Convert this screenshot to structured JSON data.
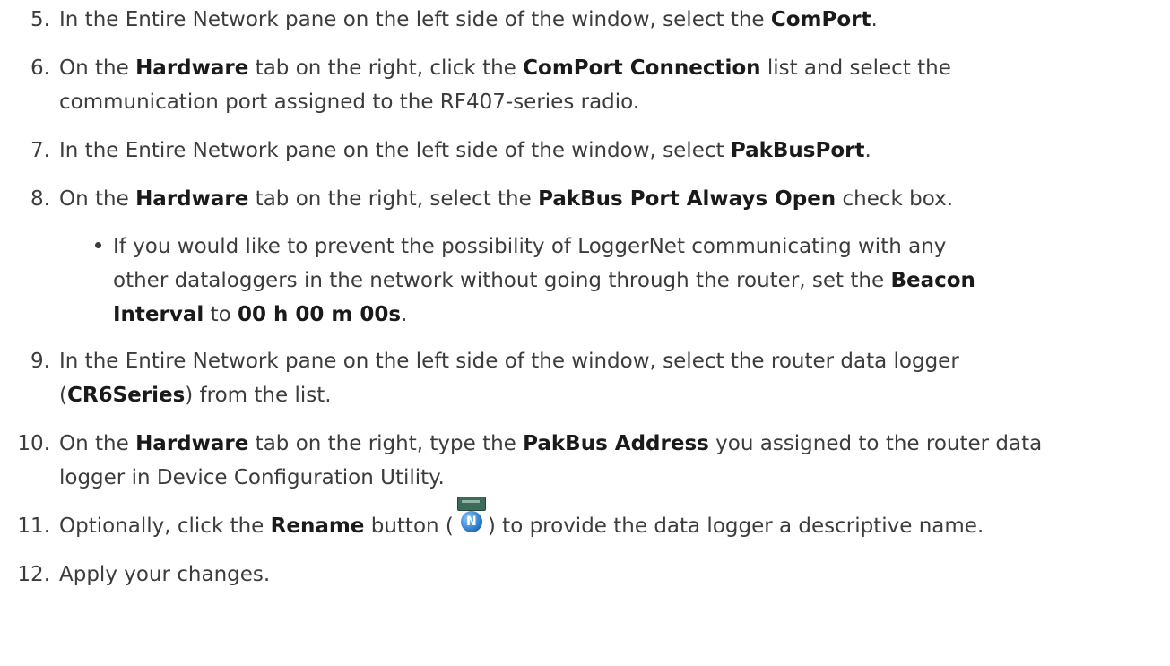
{
  "steps": [
    {
      "number": "5.",
      "parts": [
        "In the Entire Network pane on the left side of the window, select the ",
        "ComPort",
        "."
      ]
    },
    {
      "number": "6.",
      "line1": [
        "On the ",
        "Hardware",
        " tab on the right, click the ",
        "ComPort Connection",
        " list and select the"
      ],
      "line2": "communication port assigned to the RF407-series radio."
    },
    {
      "number": "7.",
      "parts": [
        "In the Entire Network pane on the left side of the window, select ",
        "PakBusPort",
        "."
      ]
    },
    {
      "number": "8.",
      "parts": [
        "On the ",
        "Hardware",
        " tab on the right, select the ",
        "PakBus Port Always Open",
        " check box."
      ]
    },
    {
      "number": "9.",
      "line1": "In the Entire Network pane on the left side of the window, select the router data logger",
      "line2": [
        "(",
        "CR6Series",
        ") from the list."
      ]
    },
    {
      "number": "10.",
      "line1": [
        "On the ",
        "Hardware",
        " tab on the right, type the ",
        "PakBus Address",
        " you assigned to the router data"
      ],
      "line2": "logger in Device Configuration Utility."
    },
    {
      "number": "11.",
      "parts": [
        "Optionally, click the ",
        "Rename",
        " button (",
        ") to provide the data logger a descriptive name."
      ]
    },
    {
      "number": "12.",
      "parts": [
        "Apply your changes."
      ]
    }
  ],
  "bullet": {
    "line1": "If you would like to prevent the possibility of LoggerNet communicating with any",
    "line2": [
      "other dataloggers in the network without going through the router, set the ",
      "Beacon"
    ],
    "line3": [
      "Interval",
      " to ",
      "00 h 00 m 00s",
      "."
    ]
  },
  "icons": {
    "rename_button": "rename-logger-icon",
    "rename_glyph": "N"
  }
}
